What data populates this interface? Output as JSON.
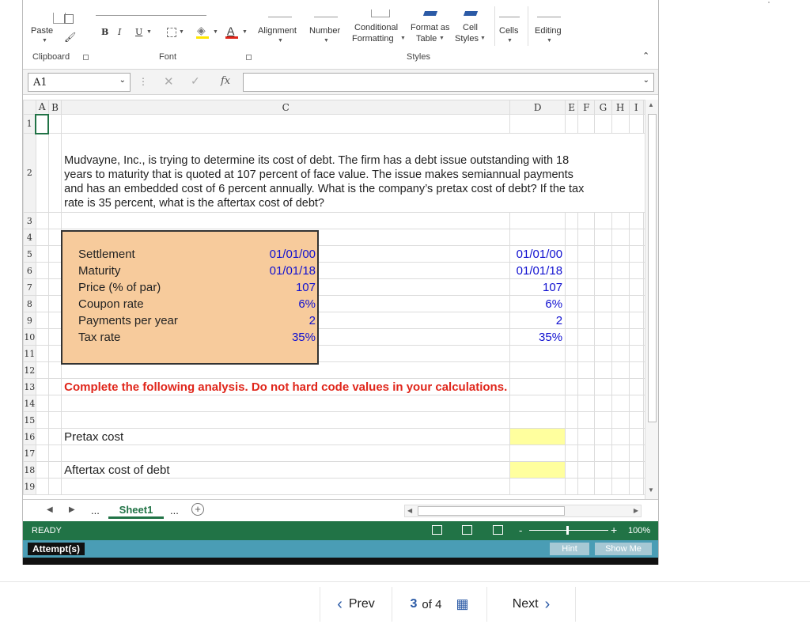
{
  "ribbon": {
    "paste": "Paste",
    "bold": "B",
    "italic": "I",
    "underline": "U",
    "alignment": "Alignment",
    "number": "Number",
    "conditional_1": "Conditional",
    "conditional_2": "Formatting",
    "format_table_1": "Format as",
    "format_table_2": "Table",
    "cell_styles_1": "Cell",
    "cell_styles_2": "Styles",
    "cells": "Cells",
    "editing": "Editing",
    "groups": {
      "clipboard": "Clipboard",
      "font": "Font",
      "styles": "Styles"
    }
  },
  "formula_bar": {
    "name_box": "A1",
    "fx": "fx",
    "content": ""
  },
  "columns": [
    "A",
    "B",
    "C",
    "D",
    "E",
    "F",
    "G",
    "H",
    "I"
  ],
  "rows": [
    "1",
    "2",
    "3",
    "4",
    "5",
    "6",
    "7",
    "8",
    "9",
    "10",
    "11",
    "12",
    "13",
    "14",
    "15",
    "16",
    "17",
    "18",
    "19"
  ],
  "sheet": {
    "problem": "Mudvayne, Inc., is trying to determine its cost of debt. The firm has a debt issue outstanding with 18 years to maturity that is quoted at 107 percent of face value. The issue makes semiannual payments and has an embedded cost of 6 percent annually. What is the company’s pretax cost of debt? If the tax rate is 35 percent, what is the aftertax cost of debt?",
    "inputs": [
      {
        "label": "Settlement",
        "value": "01/01/00"
      },
      {
        "label": "Maturity",
        "value": "01/01/18"
      },
      {
        "label": "Price (% of par)",
        "value": "107"
      },
      {
        "label": "Coupon rate",
        "value": "6%"
      },
      {
        "label": "Payments per year",
        "value": "2"
      },
      {
        "label": "Tax rate",
        "value": "35%"
      }
    ],
    "instruction": "Complete the following analysis. Do not hard code values in your calculations.",
    "pretax_label": "Pretax cost",
    "aftertax_label": "Aftertax cost of debt"
  },
  "tabs": {
    "ellipsis": "...",
    "sheet1": "Sheet1",
    "add": "+"
  },
  "status": {
    "ready": "READY",
    "zoom": "100%",
    "minus": "-",
    "plus": "+"
  },
  "attempt": {
    "label": "Attempt(s)",
    "hint": "Hint",
    "show_me": "Show Me"
  },
  "nav": {
    "prev": "Prev",
    "current": "3",
    "of": "of 4",
    "next": "Next"
  },
  "colors": {
    "input_fill": "#f7cb9c",
    "answer_fill": "#ffff9e",
    "instruction": "#e0261b",
    "status_green": "#217346",
    "attempt_teal": "#4a9db5"
  }
}
